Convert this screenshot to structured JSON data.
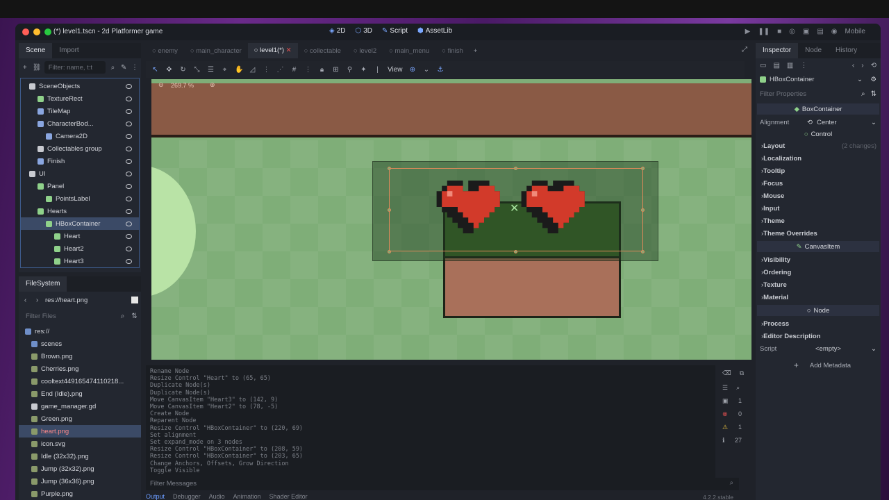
{
  "window": {
    "title": "(*) level1.tscn - 2d Platformer game",
    "modes": [
      {
        "icon": "2d-icon",
        "label": "2D"
      },
      {
        "icon": "3d-icon",
        "label": "3D"
      },
      {
        "icon": "script-icon",
        "label": "Script"
      },
      {
        "icon": "assetlib-icon",
        "label": "AssetLib"
      }
    ],
    "renderer": "Mobile"
  },
  "scene_panel": {
    "tabs": [
      "Scene",
      "Import"
    ],
    "filter_placeholder": "Filter: name, t:t",
    "nodes": [
      {
        "label": "SceneObjects",
        "indent": 1,
        "color": "#c8cad0"
      },
      {
        "label": "TextureRect",
        "indent": 2,
        "color": "#8fd18a"
      },
      {
        "label": "TileMap",
        "indent": 2,
        "color": "#8aa6e0"
      },
      {
        "label": "CharacterBod...",
        "indent": 2,
        "color": "#8aa6e0"
      },
      {
        "label": "Camera2D",
        "indent": 3,
        "color": "#8aa6e0"
      },
      {
        "label": "Collectables group",
        "indent": 2,
        "color": "#c8cad0"
      },
      {
        "label": "Finish",
        "indent": 2,
        "color": "#8aa6e0"
      },
      {
        "label": "UI",
        "indent": 1,
        "color": "#c8cad0"
      },
      {
        "label": "Panel",
        "indent": 2,
        "color": "#8fd18a"
      },
      {
        "label": "PointsLabel",
        "indent": 3,
        "color": "#8fd18a"
      },
      {
        "label": "Hearts",
        "indent": 2,
        "color": "#8fd18a"
      },
      {
        "label": "HBoxContainer",
        "indent": 3,
        "color": "#8fd18a",
        "selected": true
      },
      {
        "label": "Heart",
        "indent": 4,
        "color": "#8fd18a"
      },
      {
        "label": "Heart2",
        "indent": 4,
        "color": "#8fd18a"
      },
      {
        "label": "Heart3",
        "indent": 4,
        "color": "#8fd18a"
      }
    ]
  },
  "filesystem": {
    "title": "FileSystem",
    "path": "res://heart.png",
    "filter_placeholder": "Filter Files",
    "items": [
      {
        "label": "res://",
        "indent": 1,
        "type": "folder"
      },
      {
        "label": "scenes",
        "indent": 2,
        "type": "folder"
      },
      {
        "label": "Brown.png",
        "indent": 2,
        "type": "image"
      },
      {
        "label": "Cherries.png",
        "indent": 2,
        "type": "image"
      },
      {
        "label": "cooltext449165474110218...",
        "indent": 2,
        "type": "image"
      },
      {
        "label": "End (Idle).png",
        "indent": 2,
        "type": "image"
      },
      {
        "label": "game_manager.gd",
        "indent": 2,
        "type": "gear"
      },
      {
        "label": "Green.png",
        "indent": 2,
        "type": "image"
      },
      {
        "label": "heart.png",
        "indent": 2,
        "type": "image",
        "selected": true
      },
      {
        "label": "icon.svg",
        "indent": 2,
        "type": "image"
      },
      {
        "label": "Idle (32x32).png",
        "indent": 2,
        "type": "image"
      },
      {
        "label": "Jump (32x32).png",
        "indent": 2,
        "type": "image"
      },
      {
        "label": "Jump (36x36).png",
        "indent": 2,
        "type": "image"
      },
      {
        "label": "Purple.png",
        "indent": 2,
        "type": "image"
      }
    ]
  },
  "doc_tabs": [
    {
      "label": "enemy",
      "active": false
    },
    {
      "label": "main_character",
      "active": false
    },
    {
      "label": "level1(*)",
      "active": true
    },
    {
      "label": "collectable",
      "active": false
    },
    {
      "label": "level2",
      "active": false
    },
    {
      "label": "main_menu",
      "active": false
    },
    {
      "label": "finish",
      "active": false
    }
  ],
  "toolbar": {
    "view_label": "View"
  },
  "viewport": {
    "zoom": "269.7 %"
  },
  "output": {
    "lines": [
      "Rename Node",
      "Resize Control \"Heart\" to (65, 65)",
      "Duplicate Node(s)",
      "Duplicate Node(s)",
      "Move CanvasItem \"Heart3\" to (142, 9)",
      "Move CanvasItem \"Heart2\" to (78, -5)",
      "Create Node",
      "Reparent Node",
      "Resize Control \"HBoxContainer\" to (220, 69)",
      "Set alignment",
      "Set expand_mode on 3 nodes",
      "Resize Control \"HBoxContainer\" to (208, 59)",
      "Resize Control \"HBoxContainer\" to (203, 65)",
      "Change Anchors, Offsets, Grow Direction",
      "Toggle Visible"
    ],
    "filter_placeholder": "Filter Messages",
    "counts": {
      "messages": "1",
      "errors": "0",
      "warnings": "1",
      "info": "27"
    },
    "tabs": [
      "Output",
      "Debugger",
      "Audio",
      "Animation",
      "Shader Editor"
    ],
    "version": "4.2.2.stable"
  },
  "inspector": {
    "tabs": [
      "Inspector",
      "Node",
      "History"
    ],
    "node_name": "HBoxContainer",
    "filter_placeholder": "Filter Properties",
    "class_header": "BoxContainer",
    "alignment_label": "Alignment",
    "alignment_value": "Center",
    "control_header": "Control",
    "control_groups": [
      "Layout",
      "Localization",
      "Tooltip",
      "Focus",
      "Mouse",
      "Input",
      "Theme",
      "Theme Overrides"
    ],
    "layout_changes": "(2 changes)",
    "canvas_header": "CanvasItem",
    "canvas_groups": [
      "Visibility",
      "Ordering",
      "Texture",
      "Material"
    ],
    "node_header": "Node",
    "node_groups": [
      "Process",
      "Editor Description"
    ],
    "script_label": "Script",
    "script_value": "<empty>",
    "add_metadata": "Add Metadata"
  },
  "colors": {
    "accent": "#6b9cff",
    "selection": "#3b4a66",
    "canvas_green": "#7fae78",
    "heart_red": "#d23a2a"
  }
}
